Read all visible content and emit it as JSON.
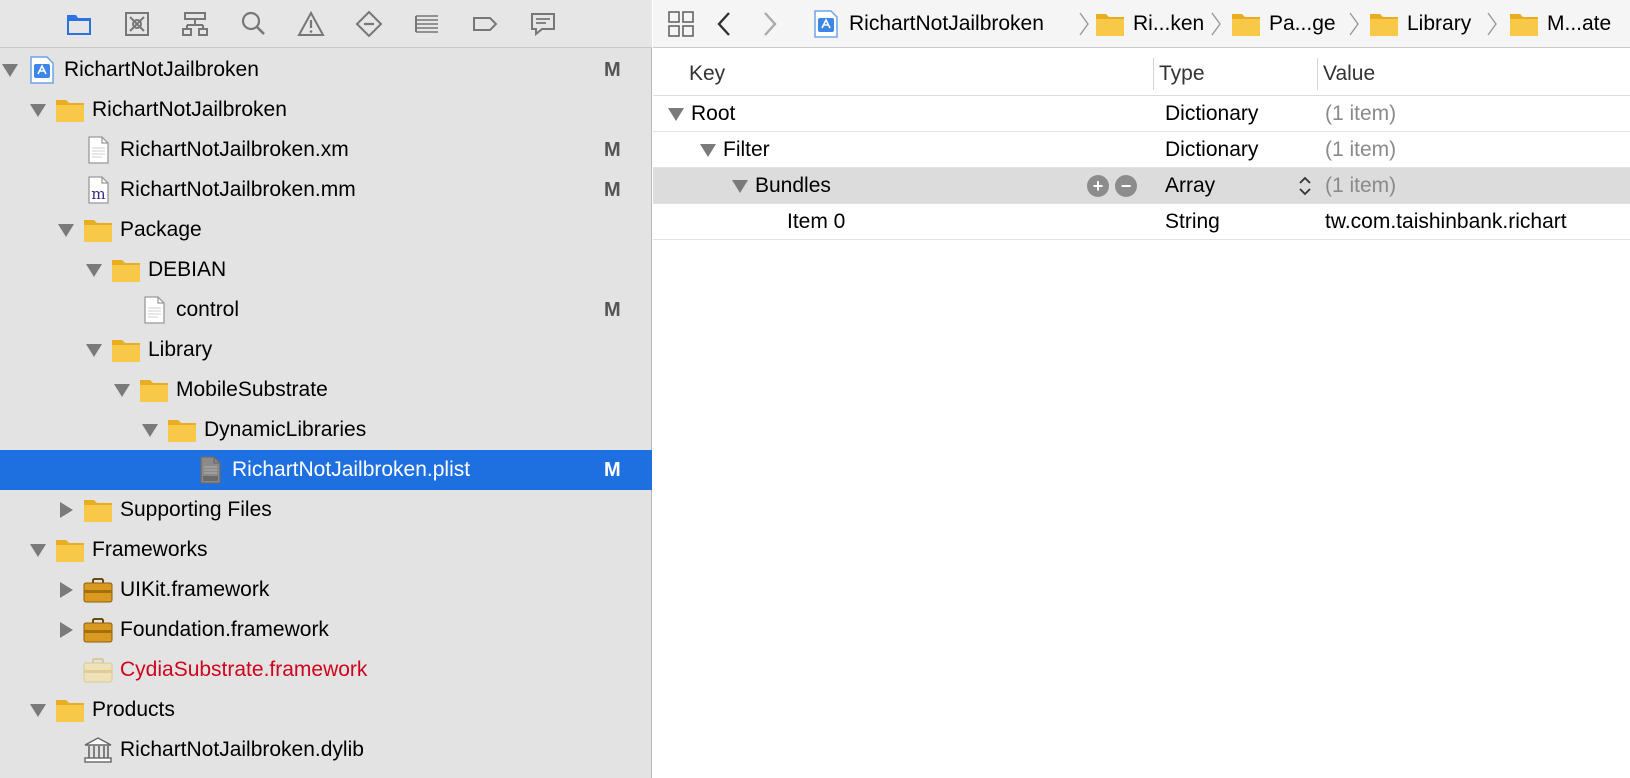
{
  "navigator": {
    "toolbar": [
      {
        "name": "project-navigator-icon"
      },
      {
        "name": "source-control-navigator-icon"
      },
      {
        "name": "symbol-navigator-icon"
      },
      {
        "name": "find-navigator-icon"
      },
      {
        "name": "issue-navigator-icon"
      },
      {
        "name": "test-navigator-icon"
      },
      {
        "name": "debug-navigator-icon"
      },
      {
        "name": "breakpoint-navigator-icon"
      },
      {
        "name": "report-navigator-icon"
      }
    ],
    "tree": [
      {
        "label": "RichartNotJailbroken",
        "badge": "M",
        "icon": "project-icon",
        "disclosure": "expanded"
      },
      {
        "label": "RichartNotJailbroken",
        "badge": "",
        "icon": "folder-icon",
        "disclosure": "expanded"
      },
      {
        "label": "RichartNotJailbroken.xm",
        "badge": "M",
        "icon": "file-icon",
        "disclosure": "none"
      },
      {
        "label": "RichartNotJailbroken.mm",
        "badge": "M",
        "icon": "objc-file-icon",
        "disclosure": "none"
      },
      {
        "label": "Package",
        "badge": "",
        "icon": "folder-icon",
        "disclosure": "expanded"
      },
      {
        "label": "DEBIAN",
        "badge": "",
        "icon": "folder-icon",
        "disclosure": "expanded"
      },
      {
        "label": "control",
        "badge": "M",
        "icon": "file-icon",
        "disclosure": "none"
      },
      {
        "label": "Library",
        "badge": "",
        "icon": "folder-icon",
        "disclosure": "expanded"
      },
      {
        "label": "MobileSubstrate",
        "badge": "",
        "icon": "folder-icon",
        "disclosure": "expanded"
      },
      {
        "label": "DynamicLibraries",
        "badge": "",
        "icon": "folder-icon",
        "disclosure": "expanded"
      },
      {
        "label": "RichartNotJailbroken.plist",
        "badge": "M",
        "icon": "plist-file-icon",
        "disclosure": "none"
      },
      {
        "label": "Supporting Files",
        "badge": "",
        "icon": "folder-icon",
        "disclosure": "collapsed"
      },
      {
        "label": "Frameworks",
        "badge": "",
        "icon": "folder-icon",
        "disclosure": "expanded"
      },
      {
        "label": "UIKit.framework",
        "badge": "",
        "icon": "framework-icon",
        "disclosure": "collapsed"
      },
      {
        "label": "Foundation.framework",
        "badge": "",
        "icon": "framework-icon",
        "disclosure": "collapsed"
      },
      {
        "label": "CydiaSubstrate.framework",
        "badge": "",
        "icon": "missing-framework-icon",
        "disclosure": "none"
      },
      {
        "label": "Products",
        "badge": "",
        "icon": "folder-icon",
        "disclosure": "expanded"
      },
      {
        "label": "RichartNotJailbroken.dylib",
        "badge": "",
        "icon": "library-icon",
        "disclosure": "none"
      }
    ]
  },
  "jump_bar": {
    "crumbs": [
      {
        "label": "RichartNotJailbroken",
        "icon": "project-icon"
      },
      {
        "label": "Ri...ken",
        "icon": "folder-icon"
      },
      {
        "label": "Pa...ge",
        "icon": "folder-icon"
      },
      {
        "label": "Library",
        "icon": "folder-icon"
      },
      {
        "label": "M...ate",
        "icon": "folder-icon"
      }
    ]
  },
  "plist": {
    "headers": {
      "key": "Key",
      "type": "Type",
      "value": "Value"
    },
    "rows": [
      {
        "key": "Root",
        "type": "Dictionary",
        "value": "(1 item)",
        "disclosure": "expanded"
      },
      {
        "key": "Filter",
        "type": "Dictionary",
        "value": "(1 item)",
        "disclosure": "expanded"
      },
      {
        "key": "Bundles",
        "type": "Array",
        "value": "(1 item)",
        "disclosure": "expanded"
      },
      {
        "key": "Item 0",
        "type": "String",
        "value": "tw.com.taishinbank.richart",
        "disclosure": "none"
      }
    ]
  },
  "colors": {
    "selection": "#1e6fe0",
    "folder": "#f5c342",
    "missing": "#d0021b",
    "navigator_bg": "#e3e3e3"
  }
}
